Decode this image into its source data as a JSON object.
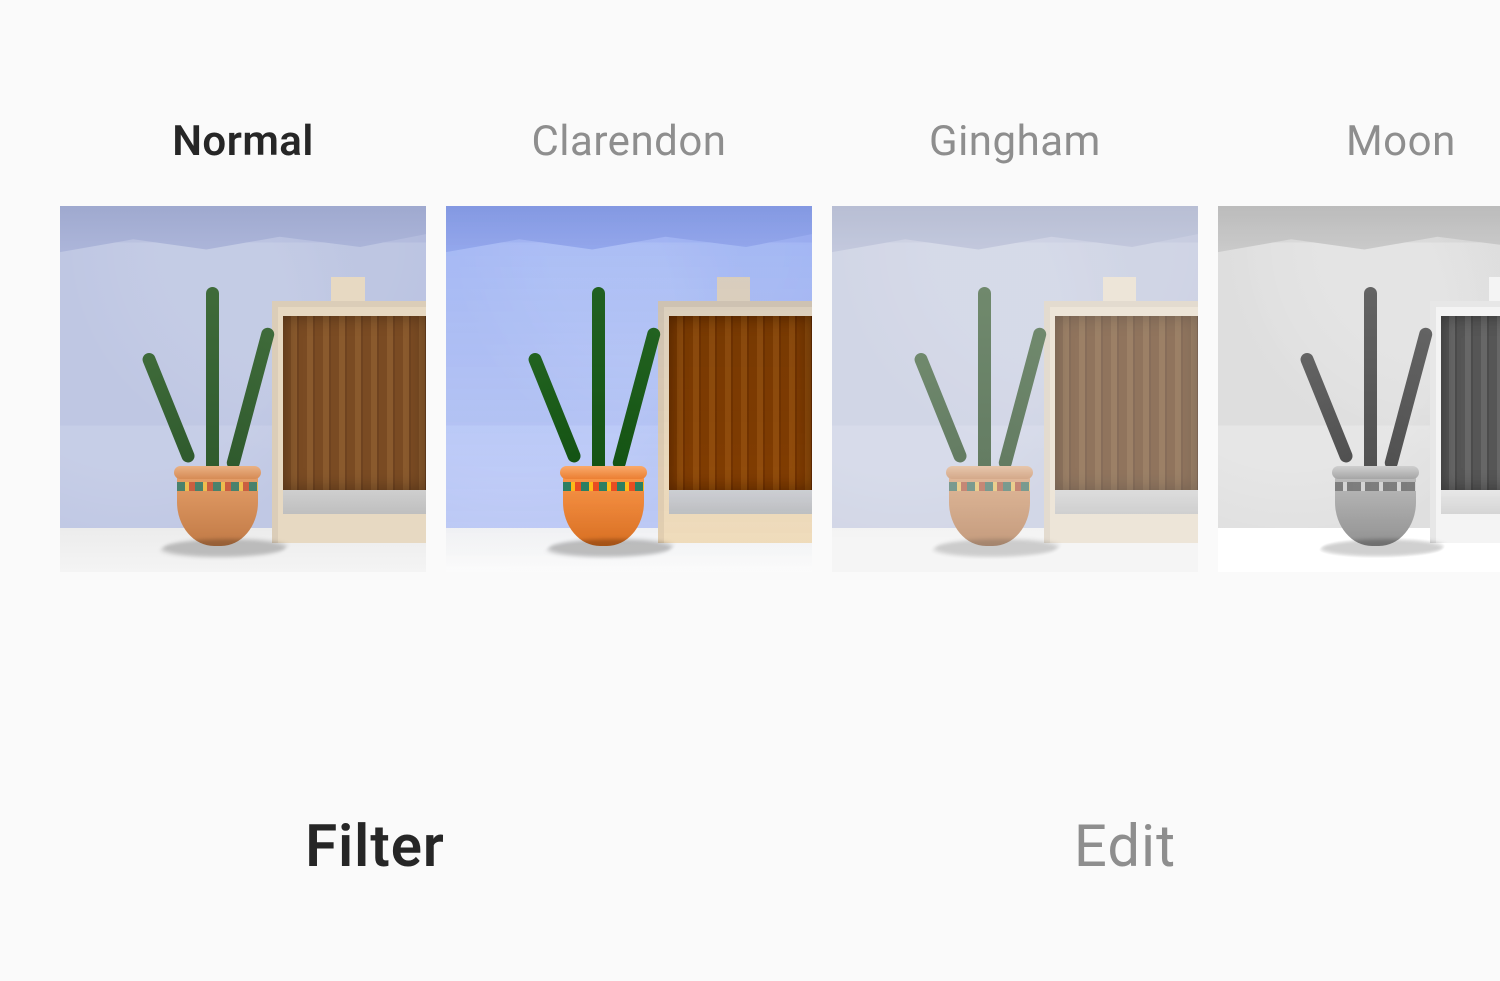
{
  "filters": [
    {
      "name": "Normal",
      "selected": true,
      "css": "normal"
    },
    {
      "name": "Clarendon",
      "selected": false,
      "css": "clarendon"
    },
    {
      "name": "Gingham",
      "selected": false,
      "css": "gingham"
    },
    {
      "name": "Moon",
      "selected": false,
      "css": "moon"
    }
  ],
  "tabs": {
    "filter": "Filter",
    "edit": "Edit",
    "active": "filter"
  }
}
